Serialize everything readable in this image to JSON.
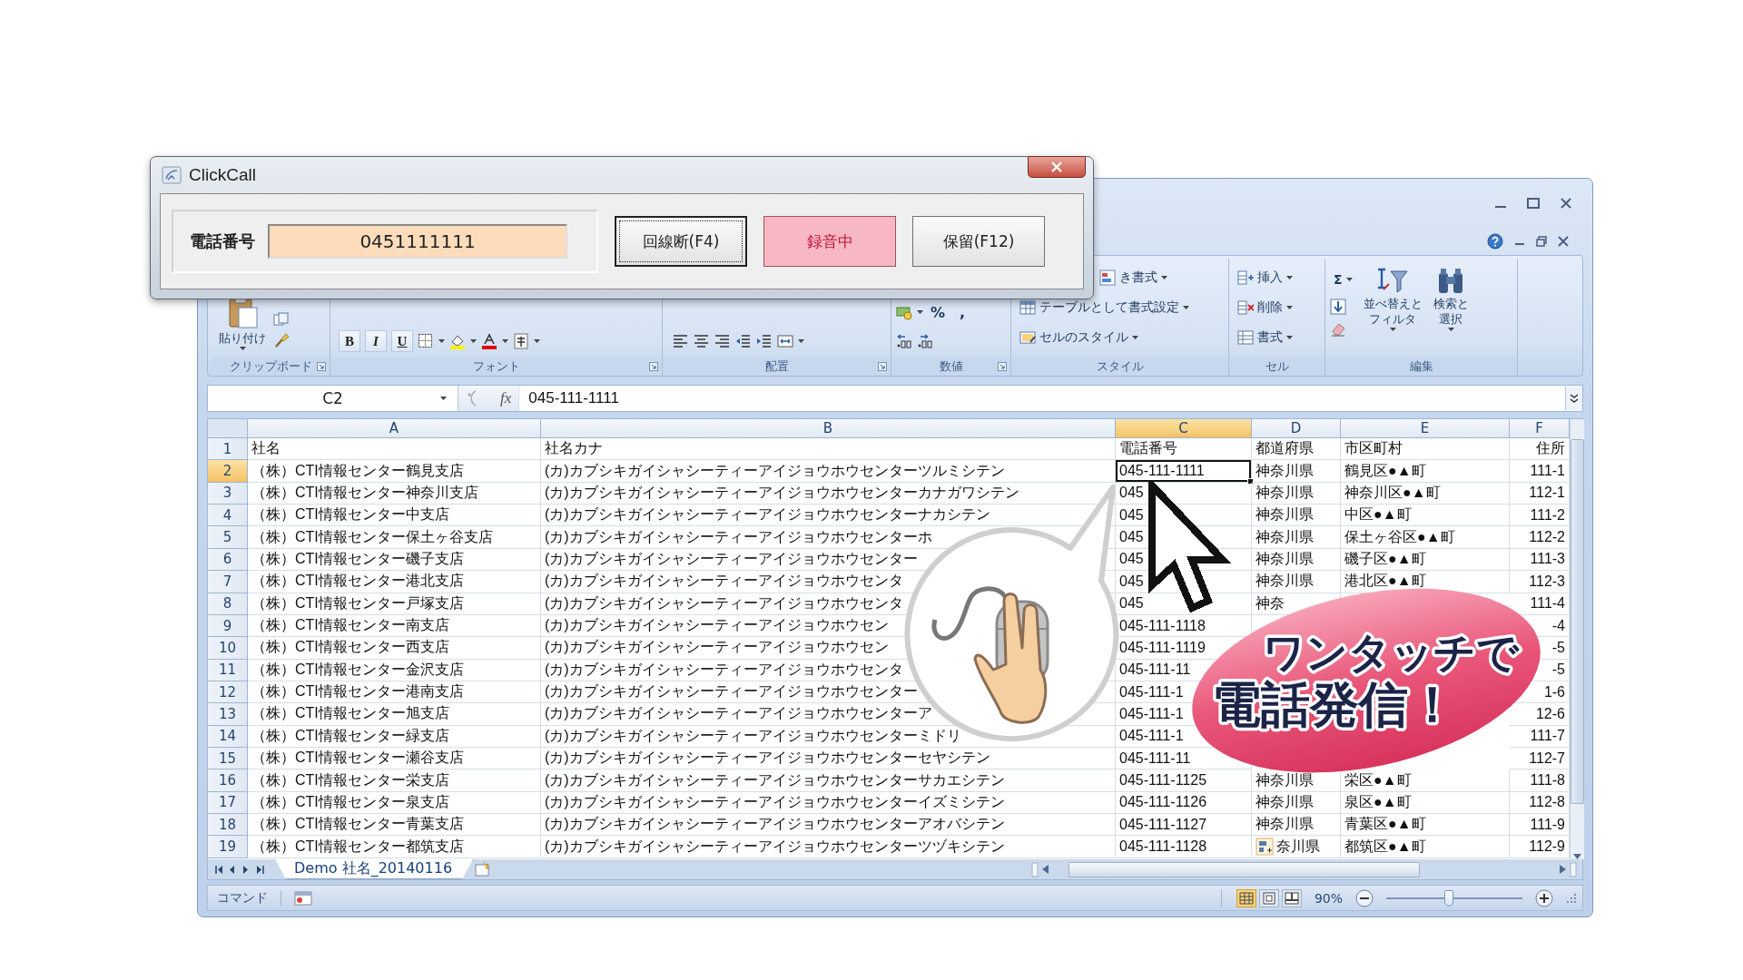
{
  "dialog": {
    "title": "ClickCall",
    "field_label": "電話番号",
    "phone": {
      "value": "0451111111"
    },
    "buttons": [
      {
        "label": "回線断(F4)",
        "kind": "focused"
      },
      {
        "label": "録音中",
        "kind": "recording"
      },
      {
        "label": "保留(F12)",
        "kind": "normal"
      }
    ]
  },
  "excel": {
    "ribbon": {
      "groups": [
        {
          "kind": "clipboard",
          "label": "クリップボード",
          "paste": "貼り付け"
        },
        {
          "kind": "font",
          "label": "フォント",
          "buttons": [
            "B",
            "I",
            "U"
          ]
        },
        {
          "kind": "alignment",
          "label": "配置"
        },
        {
          "kind": "number",
          "label": "数値",
          "symbols": [
            "%",
            ","
          ]
        },
        {
          "kind": "styles",
          "label": "スタイル",
          "commands": [
            "き書式",
            "テーブルとして書式設定",
            "セルのスタイル"
          ]
        },
        {
          "kind": "cells",
          "label": "セル",
          "commands": [
            "挿入",
            "削除",
            "書式"
          ]
        },
        {
          "kind": "editing",
          "label": "編集",
          "symbol": "Σ",
          "commands": [
            [
              "並べ替えと",
              "フィルタ"
            ],
            [
              "検索と",
              "選択"
            ]
          ]
        }
      ]
    },
    "formula_bar": {
      "name_box": "C2",
      "fx": "fx",
      "formula": "045-111-1111"
    },
    "columns": [
      {
        "label": "A",
        "selected": false
      },
      {
        "label": "B",
        "selected": false
      },
      {
        "label": "C",
        "selected": true
      },
      {
        "label": "D",
        "selected": false
      },
      {
        "label": "E",
        "selected": false
      },
      {
        "label": "F",
        "selected": false
      }
    ],
    "rows": [
      {
        "number": "1",
        "selected": false,
        "cells": {
          "A": "社名",
          "B": "社名カナ",
          "C": "電話番号",
          "D": "都道府県",
          "E": "市区町村",
          "F": "住所"
        }
      },
      {
        "number": "2",
        "selected": true,
        "cells": {
          "A": "（株）CTI情報センター鶴見支店",
          "B": "(カ)カブシキガイシャシーティーアイジョウホウセンターツルミシテン",
          "C": "045-111-1111",
          "D": "神奈川県",
          "E": "鶴見区●▲町",
          "F": "111-1"
        }
      },
      {
        "number": "3",
        "selected": false,
        "cells": {
          "A": "（株）CTI情報センター神奈川支店",
          "B": "(カ)カブシキガイシャシーティーアイジョウホウセンターカナガワシテン",
          "C": "045",
          "D": "神奈川県",
          "E": "神奈川区●▲町",
          "F": "112-1"
        }
      },
      {
        "number": "4",
        "selected": false,
        "cells": {
          "A": "（株）CTI情報センター中支店",
          "B": "(カ)カブシキガイシャシーティーアイジョウホウセンターナカシテン",
          "C": "045",
          "D": "神奈川県",
          "E": "中区●▲町",
          "F": "111-2"
        }
      },
      {
        "number": "5",
        "selected": false,
        "cells": {
          "A": "（株）CTI情報センター保土ヶ谷支店",
          "B": "(カ)カブシキガイシャシーティーアイジョウホウセンターホ",
          "C": "045",
          "D": "神奈川県",
          "E": "保土ヶ谷区●▲町",
          "F": "112-2"
        }
      },
      {
        "number": "6",
        "selected": false,
        "cells": {
          "A": "（株）CTI情報センター磯子支店",
          "B": "(カ)カブシキガイシャシーティーアイジョウホウセンター",
          "C": "045",
          "D": "神奈川県",
          "E": "磯子区●▲町",
          "F": "111-3"
        }
      },
      {
        "number": "7",
        "selected": false,
        "cells": {
          "A": "（株）CTI情報センター港北支店",
          "B": "(カ)カブシキガイシャシーティーアイジョウホウセンタ",
          "C": "045",
          "D": "神奈川県",
          "E": "港北区●▲町",
          "F": "112-3"
        }
      },
      {
        "number": "8",
        "selected": false,
        "cells": {
          "A": "（株）CTI情報センター戸塚支店",
          "B": "(カ)カブシキガイシャシーティーアイジョウホウセンタ",
          "C": "045",
          "D": "神奈",
          "F": "111-4"
        }
      },
      {
        "number": "9",
        "selected": false,
        "cells": {
          "A": "（株）CTI情報センター南支店",
          "B": "(カ)カブシキガイシャシーティーアイジョウホウセン",
          "C": "045-111-1118",
          "F": "-4"
        }
      },
      {
        "number": "10",
        "selected": false,
        "cells": {
          "A": "（株）CTI情報センター西支店",
          "B": "(カ)カブシキガイシャシーティーアイジョウホウセン",
          "C": "045-111-1119",
          "F": "-5"
        }
      },
      {
        "number": "11",
        "selected": false,
        "cells": {
          "A": "（株）CTI情報センター金沢支店",
          "B": "(カ)カブシキガイシャシーティーアイジョウホウセンタ",
          "C": "045-111-11",
          "F": "-5"
        }
      },
      {
        "number": "12",
        "selected": false,
        "cells": {
          "A": "（株）CTI情報センター港南支店",
          "B": "(カ)カブシキガイシャシーティーアイジョウホウセンター",
          "C": "045-111-1",
          "F": "1-6"
        }
      },
      {
        "number": "13",
        "selected": false,
        "cells": {
          "A": "（株）CTI情報センター旭支店",
          "B": "(カ)カブシキガイシャシーティーアイジョウホウセンターア",
          "C": "045-111-1",
          "F": "12-6"
        }
      },
      {
        "number": "14",
        "selected": false,
        "cells": {
          "A": "（株）CTI情報センター緑支店",
          "B": "(カ)カブシキガイシャシーティーアイジョウホウセンターミドリ",
          "C": "045-111-1",
          "F": "111-7"
        }
      },
      {
        "number": "15",
        "selected": false,
        "cells": {
          "A": "（株）CTI情報センター瀬谷支店",
          "B": "(カ)カブシキガイシャシーティーアイジョウホウセンターセヤシテン",
          "C": "045-111-11",
          "F": "112-7"
        }
      },
      {
        "number": "16",
        "selected": false,
        "cells": {
          "A": "（株）CTI情報センター栄支店",
          "B": "(カ)カブシキガイシャシーティーアイジョウホウセンターサカエシテン",
          "C": "045-111-1125",
          "D": "神奈川県",
          "E": "栄区●▲町",
          "F": "111-8"
        }
      },
      {
        "number": "17",
        "selected": false,
        "cells": {
          "A": "（株）CTI情報センター泉支店",
          "B": "(カ)カブシキガイシャシーティーアイジョウホウセンターイズミシテン",
          "C": "045-111-1126",
          "D": "神奈川県",
          "E": "泉区●▲町",
          "F": "112-8"
        }
      },
      {
        "number": "18",
        "selected": false,
        "cells": {
          "A": "（株）CTI情報センター青葉支店",
          "B": "(カ)カブシキガイシャシーティーアイジョウホウセンターアオバシテン",
          "C": "045-111-1127",
          "D": "神奈川県",
          "E": "青葉区●▲町",
          "F": "111-9"
        }
      },
      {
        "number": "19",
        "selected": false,
        "cells": {
          "A": "（株）CTI情報センター都筑支店",
          "B": "(カ)カブシキガイシャシーティーアイジョウホウセンターツヅキシテン",
          "C": "045-111-1128",
          "D": "奈川県",
          "E": "都筑区●▲町",
          "F": "112-9"
        }
      }
    ],
    "sheet_tabs": [
      {
        "label": "Demo 社名_20140116",
        "selected": true
      }
    ],
    "status_bar": {
      "mode": "コマンド",
      "views": [
        {
          "selected": true
        },
        {
          "selected": false
        },
        {
          "selected": false
        }
      ],
      "zoom": "90%",
      "zoom_slider": {
        "level": 0.46
      }
    }
  },
  "badge": {
    "lines": [
      "ワンタッチで",
      "電話発信！"
    ]
  }
}
